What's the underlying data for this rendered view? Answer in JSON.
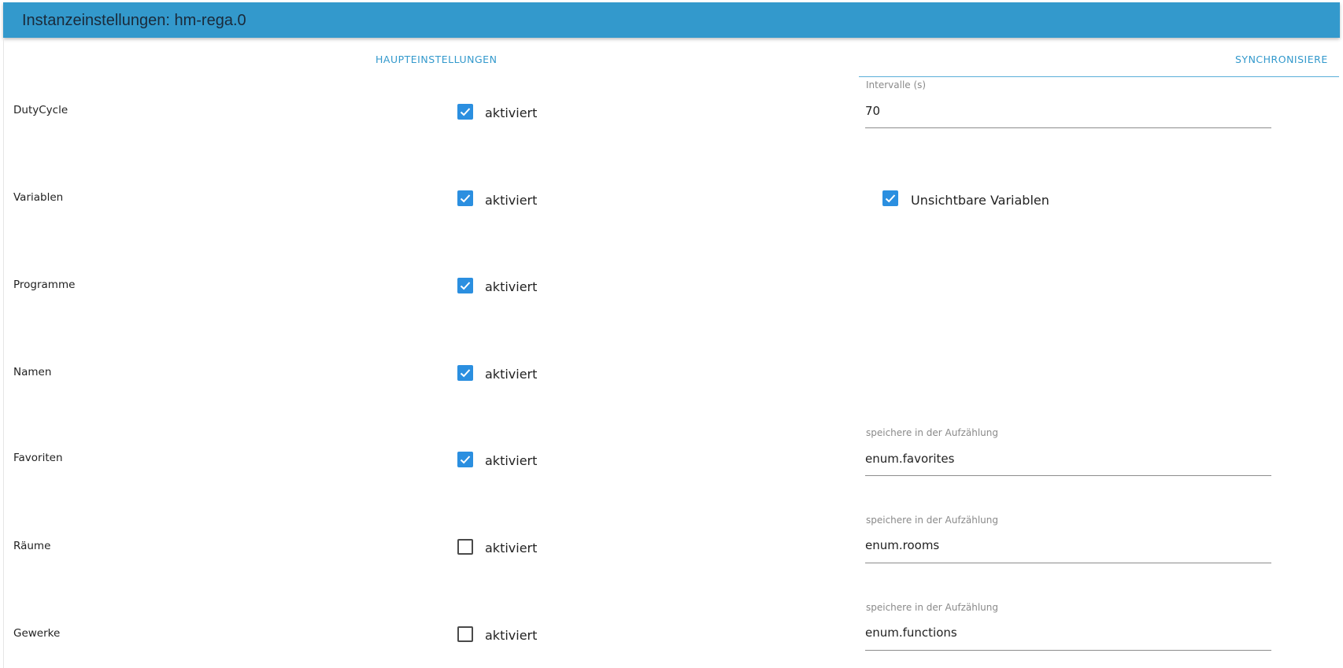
{
  "header": {
    "title": "Instanzeinstellungen: hm-rega.0"
  },
  "tabs": {
    "main_label": "HAUPTEINSTELLUNGEN",
    "sync_label": "SYNCHRONISIERE"
  },
  "colors": {
    "header_bg": "#3399cc",
    "accent": "#2b8fe0",
    "tab_text": "#3399cc"
  },
  "rows": [
    {
      "label": "DutyCycle",
      "checkbox_label": "aktiviert",
      "checked": true
    },
    {
      "label": "Variablen",
      "checkbox_label": "aktiviert",
      "checked": true
    },
    {
      "label": "Programme",
      "checkbox_label": "aktiviert",
      "checked": true
    },
    {
      "label": "Namen",
      "checkbox_label": "aktiviert",
      "checked": true
    },
    {
      "label": "Favoriten",
      "checkbox_label": "aktiviert",
      "checked": true
    },
    {
      "label": "Räume",
      "checkbox_label": "aktiviert",
      "checked": false
    },
    {
      "label": "Gewerke",
      "checkbox_label": "aktiviert",
      "checked": false
    }
  ],
  "fields": {
    "interval": {
      "caption": "Intervalle (s)",
      "value": "70"
    },
    "invisible_vars": {
      "label": "Unsichtbare Variablen",
      "checked": true
    },
    "favorites_enum": {
      "caption": "speichere in der Aufzählung",
      "value": "enum.favorites"
    },
    "rooms_enum": {
      "caption": "speichere in der Aufzählung",
      "value": "enum.rooms"
    },
    "functions_enum": {
      "caption": "speichere in der Aufzählung",
      "value": "enum.functions"
    }
  },
  "icons": {
    "checkmark": "check-icon"
  }
}
